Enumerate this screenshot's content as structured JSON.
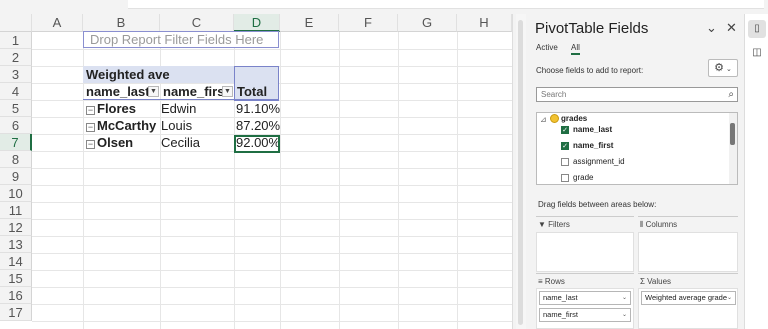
{
  "sheet": {
    "columns": [
      "A",
      "B",
      "C",
      "D",
      "E",
      "F",
      "G",
      "H"
    ],
    "selected_column": "D",
    "rows": [
      "1",
      "2",
      "3",
      "4",
      "5",
      "6",
      "7",
      "8",
      "9",
      "10",
      "11",
      "12",
      "13",
      "14",
      "15",
      "16",
      "17"
    ],
    "selected_row": "7"
  },
  "pivot": {
    "drop_filter_text": "Drop Report Filter Fields Here",
    "title": "Weighted ave",
    "col_last": "name_last",
    "col_first": "name_first",
    "col_total": "Total",
    "rows": [
      {
        "last": "Flores",
        "first": "Edwin",
        "total": "91.10%"
      },
      {
        "last": "McCarthy",
        "first": "Louis",
        "total": "87.20%"
      },
      {
        "last": "Olsen",
        "first": "Cecilia",
        "total": "92.00%"
      }
    ]
  },
  "pane": {
    "title": "PivotTable Fields",
    "tabs": [
      "Active",
      "All"
    ],
    "active_tab": "All",
    "choose_label": "Choose fields to add to report:",
    "search_placeholder": "Search",
    "table_name": "grades",
    "fields": [
      {
        "label": "name_last",
        "checked": true
      },
      {
        "label": "name_first",
        "checked": true
      },
      {
        "label": "assignment_id",
        "checked": false
      },
      {
        "label": "grade",
        "checked": false
      }
    ],
    "drag_label": "Drag fields between areas below:",
    "areas": {
      "filters": "Filters",
      "columns": "Columns",
      "rows": "Rows",
      "values": "Values"
    },
    "row_chips": [
      "name_last",
      "name_first"
    ],
    "value_chips": [
      "Weighted average grade"
    ]
  },
  "colors": {
    "accent": "#1f6e43",
    "pivot_header": "#dbe1f1",
    "pivot_border": "#7a83c9"
  }
}
